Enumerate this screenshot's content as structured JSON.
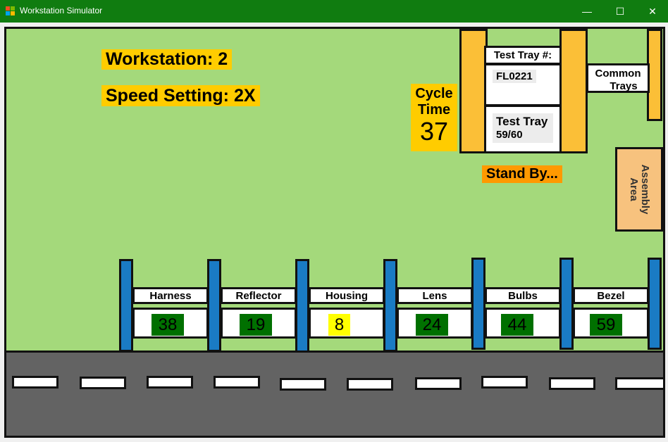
{
  "window": {
    "title": "Workstation Simulator",
    "controls": {
      "minimize": "—",
      "maximize": "☐",
      "close": "✕"
    },
    "titlebar_color": "#107c10"
  },
  "info": {
    "workstation": "Workstation: 2",
    "speed": "Speed Setting: 2X",
    "cycle_label_1": "Cycle",
    "cycle_label_2": "Time",
    "cycle_value": "37",
    "status": "Stand By..."
  },
  "test_tray": {
    "header": "Test Tray #:",
    "id": "FL0221",
    "count_line1": "Test Tray",
    "count_line2": "59/60"
  },
  "common_trays": {
    "line1": "Common",
    "line2": "Trays"
  },
  "assembly_area": {
    "line1": "Assembly",
    "line2": "Area"
  },
  "bins": [
    {
      "label": "Harness",
      "count": "38",
      "status": "ok"
    },
    {
      "label": "Reflector",
      "count": "19",
      "status": "ok"
    },
    {
      "label": "Housing",
      "count": "8",
      "status": "low"
    },
    {
      "label": "Lens",
      "count": "24",
      "status": "ok"
    },
    {
      "label": "Bulbs",
      "count": "44",
      "status": "ok"
    },
    {
      "label": "Bezel",
      "count": "59",
      "status": "ok"
    }
  ],
  "colors": {
    "floor": "#a4d97b",
    "road": "#636363",
    "post": "#1a7bc4",
    "ok_bg": "#007000",
    "low_bg": "#ffff00",
    "highlight": "#ffcc00",
    "status_bg": "#ff9900",
    "assembly_bg": "#f7c27e"
  }
}
